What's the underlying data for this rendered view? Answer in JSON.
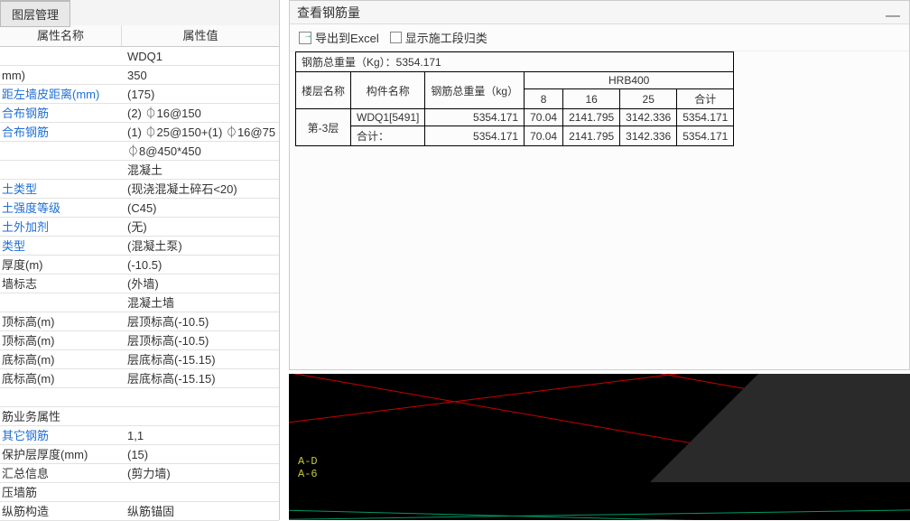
{
  "left": {
    "tab": "图层管理",
    "headers": {
      "name": "属性名称",
      "value": "属性值"
    },
    "rows": [
      {
        "n": "",
        "v": "WDQ1"
      },
      {
        "n": "mm)",
        "v": "350"
      },
      {
        "n": "距左墙皮距离(mm)",
        "v": "(175)",
        "link": true
      },
      {
        "n": "合布钢筋",
        "v": "(2) ⏀16@150",
        "link": true
      },
      {
        "n": "合布钢筋",
        "v": "(1) ⏀25@150+(1) ⏀16@75",
        "link": true
      },
      {
        "n": "",
        "v": "⏀8@450*450"
      },
      {
        "n": "",
        "v": "混凝土"
      },
      {
        "n": "土类型",
        "v": "(现浇混凝土碎石<20)",
        "link": true
      },
      {
        "n": "土强度等级",
        "v": "(C45)",
        "link": true
      },
      {
        "n": "土外加剂",
        "v": "(无)",
        "link": true
      },
      {
        "n": "类型",
        "v": "(混凝土泵)",
        "link": true
      },
      {
        "n": "厚度(m)",
        "v": "(-10.5)"
      },
      {
        "n": "墙标志",
        "v": "(外墙)"
      },
      {
        "n": "",
        "v": "混凝土墙"
      },
      {
        "n": "顶标高(m)",
        "v": "层顶标高(-10.5)"
      },
      {
        "n": "顶标高(m)",
        "v": "层顶标高(-10.5)"
      },
      {
        "n": "底标高(m)",
        "v": "层底标高(-15.15)"
      },
      {
        "n": "底标高(m)",
        "v": "层底标高(-15.15)"
      },
      {
        "n": "",
        "v": ""
      },
      {
        "n": "筋业务属性",
        "v": ""
      },
      {
        "n": "其它钢筋",
        "v": "1,1",
        "link": true
      },
      {
        "n": "保护层厚度(mm)",
        "v": "(15)"
      },
      {
        "n": "汇总信息",
        "v": "(剪力墙)"
      },
      {
        "n": "压墙筋",
        "v": ""
      },
      {
        "n": "纵筋构造",
        "v": "纵筋锚固"
      }
    ]
  },
  "dialog": {
    "title": "查看钢筋量",
    "exportLabel": "导出到Excel",
    "showCheckLabel": "显示施工段归类",
    "totalLabel": "钢筋总重量（Kg）：5354.171",
    "table": {
      "headers": {
        "floor": "楼层名称",
        "component": "构件名称",
        "totalWeight": "钢筋总重量（kg）",
        "group": "HRB400",
        "s8": "8",
        "s16": "16",
        "s25": "25",
        "sum": "合计"
      },
      "rows": [
        {
          "floor": "第-3层",
          "comp": "WDQ1[5491]",
          "tw": "5354.171",
          "c8": "70.04",
          "c16": "2141.795",
          "c25": "3142.336",
          "csum": "5354.171"
        },
        {
          "floor": "",
          "comp": "合计：",
          "tw": "5354.171",
          "c8": "70.04",
          "c16": "2141.795",
          "c25": "3142.336",
          "csum": "5354.171"
        }
      ]
    }
  },
  "cad": {
    "labels": [
      "A-D",
      "A-6"
    ]
  }
}
